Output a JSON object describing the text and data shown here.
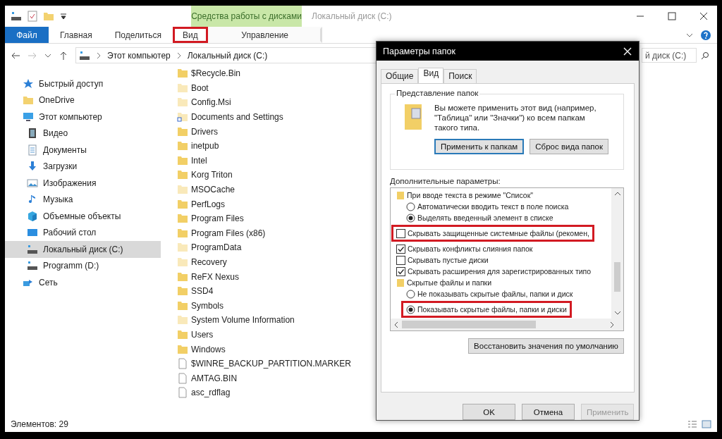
{
  "explorer": {
    "title": "Локальный диск (C:)",
    "context_tab": "Средства работы с дисками",
    "ribbon_tabs": [
      {
        "label": "Файл",
        "kind": "file",
        "highlighted": false
      },
      {
        "label": "Главная",
        "kind": "plain",
        "highlighted": false
      },
      {
        "label": "Поделиться",
        "kind": "plain",
        "highlighted": false
      },
      {
        "label": "Вид",
        "kind": "plain",
        "highlighted": true
      },
      {
        "label": "Управление",
        "kind": "context",
        "highlighted": false
      }
    ],
    "breadcrumb": [
      "Этот компьютер",
      "Локальный диск (C:)"
    ],
    "search": {
      "placeholder": "й диск (C:)"
    },
    "sidebar": [
      {
        "label": "Быстрый доступ",
        "kind": "star",
        "selected": false
      },
      {
        "label": "OneDrive",
        "kind": "folder",
        "selected": false
      },
      {
        "label": "Этот компьютер",
        "kind": "pc",
        "selected": false,
        "children": [
          {
            "label": "Видео",
            "kind": "film",
            "selected": false
          },
          {
            "label": "Документы",
            "kind": "doc",
            "selected": false
          },
          {
            "label": "Загрузки",
            "kind": "down",
            "selected": false
          },
          {
            "label": "Изображения",
            "kind": "image",
            "selected": false
          },
          {
            "label": "Музыка",
            "kind": "note",
            "selected": false
          },
          {
            "label": "Объемные объекты",
            "kind": "cube",
            "selected": false
          },
          {
            "label": "Рабочий стол",
            "kind": "desktop",
            "selected": false
          },
          {
            "label": "Локальный диск (C:)",
            "kind": "drive",
            "selected": true
          },
          {
            "label": "Programm (D:)",
            "kind": "drive",
            "selected": false
          }
        ]
      },
      {
        "label": "Сеть",
        "kind": "network",
        "selected": false
      }
    ],
    "files": [
      {
        "name": "$Recycle.Bin",
        "kind": "folder",
        "hidden": false
      },
      {
        "name": "Boot",
        "kind": "folder",
        "hidden": true
      },
      {
        "name": "Config.Msi",
        "kind": "folder",
        "hidden": true
      },
      {
        "name": "Documents and Settings",
        "kind": "shortcut",
        "hidden": true
      },
      {
        "name": "Drivers",
        "kind": "folder",
        "hidden": false
      },
      {
        "name": "inetpub",
        "kind": "folder",
        "hidden": false
      },
      {
        "name": "Intel",
        "kind": "folder",
        "hidden": false
      },
      {
        "name": "Korg Triton",
        "kind": "folder",
        "hidden": false
      },
      {
        "name": "MSOCache",
        "kind": "folder",
        "hidden": true
      },
      {
        "name": "PerfLogs",
        "kind": "folder",
        "hidden": false
      },
      {
        "name": "Program Files",
        "kind": "folder",
        "hidden": false
      },
      {
        "name": "Program Files (x86)",
        "kind": "folder",
        "hidden": false
      },
      {
        "name": "ProgramData",
        "kind": "folder",
        "hidden": true
      },
      {
        "name": "Recovery",
        "kind": "folder",
        "hidden": true
      },
      {
        "name": "ReFX Nexus",
        "kind": "folder",
        "hidden": false
      },
      {
        "name": "SSD4",
        "kind": "folder",
        "hidden": false
      },
      {
        "name": "Symbols",
        "kind": "folder",
        "hidden": false
      },
      {
        "name": "System Volume Information",
        "kind": "folder",
        "hidden": true
      },
      {
        "name": "Users",
        "kind": "folder",
        "hidden": false
      },
      {
        "name": "Windows",
        "kind": "folder",
        "hidden": false
      },
      {
        "name": "$WINRE_BACKUP_PARTITION.MARKER",
        "kind": "file",
        "hidden": false
      },
      {
        "name": "AMTAG.BIN",
        "kind": "file",
        "hidden": false
      },
      {
        "name": "asc_rdflag",
        "kind": "file",
        "hidden": false
      }
    ],
    "status_bar": "Элементов: 29"
  },
  "dialog": {
    "title": "Параметры папок",
    "tabs": [
      {
        "label": "Общие",
        "selected": false
      },
      {
        "label": "Вид",
        "selected": true
      },
      {
        "label": "Поиск",
        "selected": false
      }
    ],
    "folder_views": {
      "title": "Представление папок",
      "text": "Вы можете применить этот вид (например, \"Таблица\" или \"Значки\") ко всем папкам такого типа.",
      "buttons": [
        {
          "label": "Применить к папкам",
          "focused": true
        },
        {
          "label": "Сброс вида папок",
          "focused": false
        }
      ]
    },
    "advanced_label": "Дополнительные параметры:",
    "advanced": [
      {
        "kind": "folder",
        "label": "При вводе текста в режиме \"Список\"",
        "highlighted": false,
        "children": [
          {
            "kind": "radio",
            "label": "Автоматически вводить текст в поле поиска",
            "selected": false,
            "highlighted": false
          },
          {
            "kind": "radio",
            "label": "Выделять введенный элемент в списке",
            "selected": true,
            "highlighted": false
          }
        ]
      },
      {
        "kind": "checkbox",
        "label": "Скрывать защищенные системные файлы (рекомен,",
        "checked": false,
        "highlighted": true
      },
      {
        "kind": "checkbox",
        "label": "Скрывать конфликты слияния папок",
        "checked": true,
        "highlighted": false
      },
      {
        "kind": "checkbox",
        "label": "Скрывать пустые диски",
        "checked": false,
        "highlighted": false
      },
      {
        "kind": "checkbox",
        "label": "Скрывать расширения для зарегистрированных типо",
        "checked": true,
        "highlighted": false
      },
      {
        "kind": "folder",
        "label": "Скрытые файлы и папки",
        "highlighted": false,
        "children": [
          {
            "kind": "radio",
            "label": "Не показывать скрытые файлы, папки и диск",
            "selected": false,
            "highlighted": false
          },
          {
            "kind": "radio",
            "label": "Показывать скрытые файлы, папки и диски",
            "selected": true,
            "highlighted": true
          }
        ]
      }
    ],
    "restore_button": "Восстановить значения по умолчанию",
    "buttons": [
      {
        "label": "OK",
        "disabled": false
      },
      {
        "label": "Отмена",
        "disabled": false
      },
      {
        "label": "Применить",
        "disabled": true
      }
    ]
  }
}
